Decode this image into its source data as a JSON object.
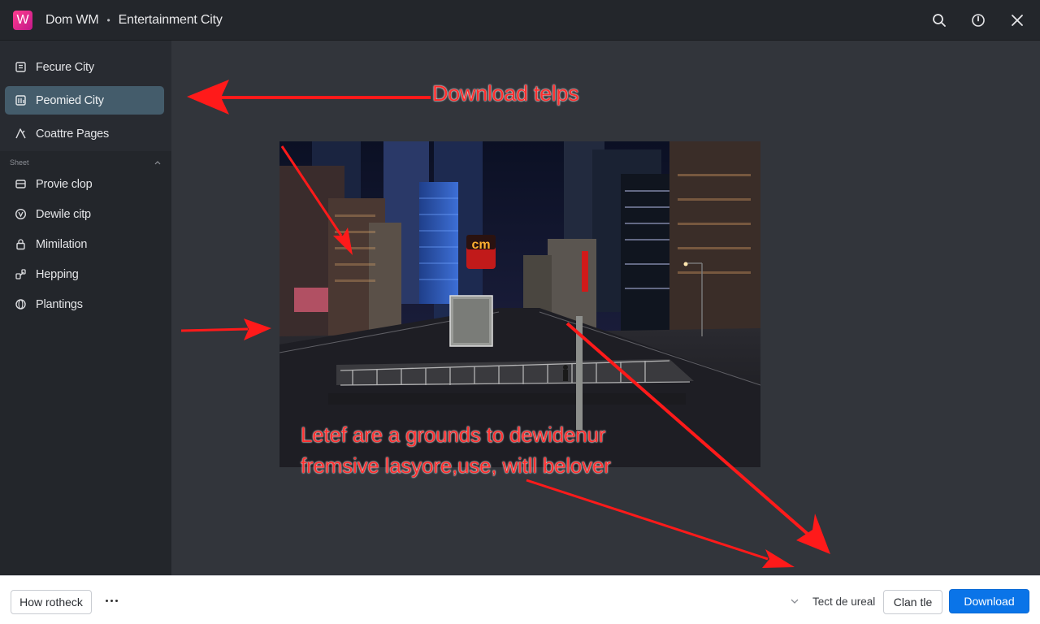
{
  "titlebar": {
    "logo_letter": "W",
    "app_name": "Dom WM",
    "separator": "•",
    "window_title": "Entertainment City",
    "icons": [
      "search-icon",
      "power-icon",
      "close-icon"
    ]
  },
  "sidebar": {
    "items": [
      {
        "label": "Fecure City",
        "icon": "building-icon",
        "active": false
      },
      {
        "label": "Peomied City",
        "icon": "city-icon",
        "active": true
      },
      {
        "label": "Coattre Pages",
        "icon": "pen-icon",
        "active": false
      }
    ],
    "section": {
      "label": "Sheet",
      "items": [
        {
          "label": "Provie clop",
          "icon": "card-icon"
        },
        {
          "label": "Dewile citp",
          "icon": "shield-icon"
        },
        {
          "label": "Mimilation",
          "icon": "lock-icon"
        },
        {
          "label": "Hepping",
          "icon": "link-icon"
        },
        {
          "label": "Plantings",
          "icon": "globe-icon"
        }
      ]
    }
  },
  "main": {
    "annotation_top": "Download telps",
    "caption_line1": "Letef are a grounds to dewidenur",
    "caption_line2": "fremsive lasyore,use, witll belover",
    "photo_sign": "cm",
    "annotation_color": "#ff2020"
  },
  "footer": {
    "left_button": "How rotheck",
    "select_value": "Tect de ureal",
    "clear_button": "Clan tle",
    "download_button": "Download",
    "accent_color": "#0a74e8"
  }
}
